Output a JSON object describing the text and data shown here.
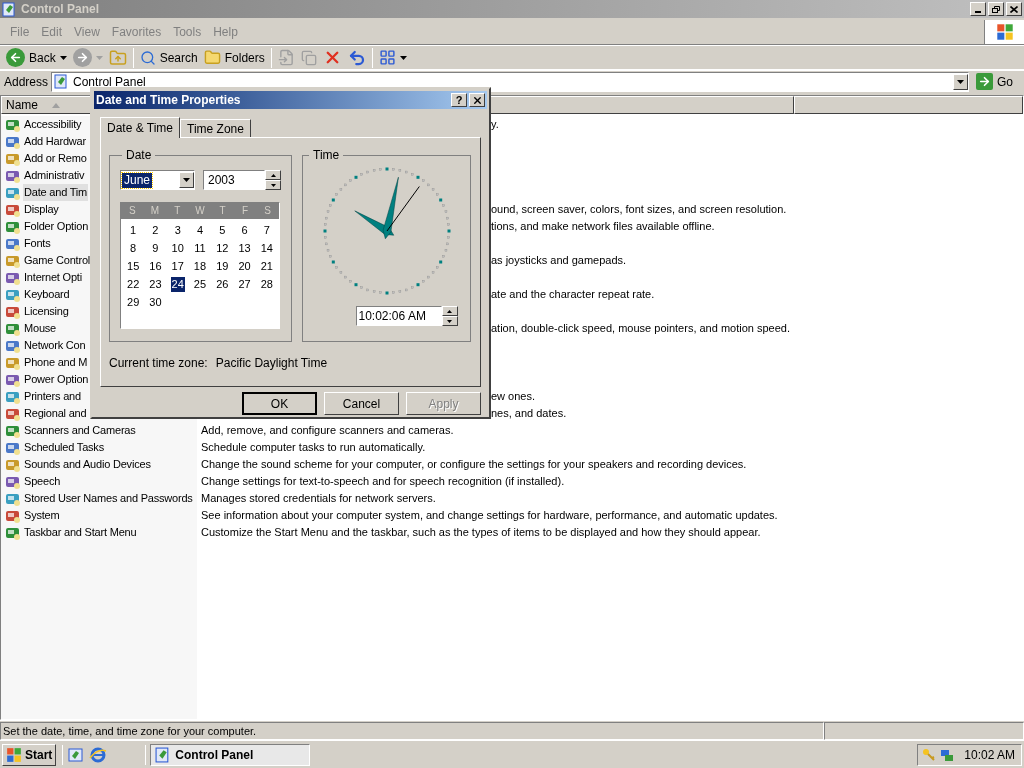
{
  "window": {
    "title": "Control Panel"
  },
  "menu": [
    "File",
    "Edit",
    "View",
    "Favorites",
    "Tools",
    "Help"
  ],
  "toolbar": [
    {
      "kind": "back",
      "label": "Back",
      "disabled": false
    },
    {
      "kind": "forward",
      "disabled": true
    },
    {
      "kind": "up",
      "disabled": false
    },
    {
      "kind": "search",
      "label": "Search",
      "disabled": false
    },
    {
      "kind": "folders",
      "label": "Folders",
      "disabled": false
    },
    {
      "kind": "move",
      "disabled": true
    },
    {
      "kind": "copy",
      "disabled": true
    },
    {
      "kind": "delete",
      "disabled": false
    },
    {
      "kind": "undo",
      "disabled": false
    },
    {
      "kind": "views",
      "disabled": false
    }
  ],
  "address": {
    "label": "Address",
    "value": "Control Panel",
    "go": "Go"
  },
  "list": {
    "columns": [
      "Name"
    ],
    "rows": [
      {
        "name": "Accessibility",
        "description": "y.",
        "kind": "covered",
        "selected": false
      },
      {
        "name": "Add Hardwar",
        "selected": false
      },
      {
        "name": "Add or Remo",
        "selected": false
      },
      {
        "name": "Administrativ",
        "selected": false
      },
      {
        "name": "Date and Tim",
        "selected": true
      },
      {
        "name": "Display",
        "description": "ound, screen saver, colors, font sizes, and screen resolution.",
        "kind": "covered",
        "selected": false
      },
      {
        "name": "Folder Option",
        "description": "tions, and make network files available offline.",
        "kind": "covered",
        "selected": false
      },
      {
        "name": "Fonts",
        "selected": false
      },
      {
        "name": "Game Control",
        "description": "as joysticks and gamepads.",
        "kind": "covered",
        "selected": false
      },
      {
        "name": "Internet Opti",
        "selected": false
      },
      {
        "name": "Keyboard",
        "description": "ate and the character repeat rate.",
        "kind": "covered",
        "selected": false
      },
      {
        "name": "Licensing",
        "selected": false
      },
      {
        "name": "Mouse",
        "description": "ation, double-click speed, mouse pointers, and motion speed.",
        "kind": "covered",
        "selected": false
      },
      {
        "name": "Network Con",
        "selected": false
      },
      {
        "name": "Phone and M",
        "selected": false
      },
      {
        "name": "Power Option",
        "selected": false
      },
      {
        "name": "Printers and",
        "description": "ew ones.",
        "kind": "covered",
        "selected": false
      },
      {
        "name": "Regional and",
        "description": "nes, and dates.",
        "kind": "covered",
        "selected": false
      },
      {
        "name": "Scanners and Cameras",
        "description": "Add, remove, and configure scanners and cameras.",
        "kind": "full",
        "selected": false
      },
      {
        "name": "Scheduled Tasks",
        "description": "Schedule computer tasks to run automatically.",
        "kind": "full",
        "selected": false
      },
      {
        "name": "Sounds and Audio Devices",
        "description": "Change the sound scheme for your computer, or configure the settings for your speakers and recording devices.",
        "kind": "full",
        "selected": false
      },
      {
        "name": "Speech",
        "description": "Change settings for text-to-speech and for speech recognition (if installed).",
        "kind": "full",
        "selected": false
      },
      {
        "name": "Stored User Names and Passwords",
        "description": "Manages stored credentials for network servers.",
        "kind": "full",
        "selected": false
      },
      {
        "name": "System",
        "description": "See information about your computer system, and change settings for hardware, performance, and automatic updates.",
        "kind": "full",
        "selected": false
      },
      {
        "name": "Taskbar and Start Menu",
        "description": "Customize the Start Menu and the taskbar, such as the types of items to be displayed and how they should appear.",
        "kind": "full",
        "selected": false
      }
    ]
  },
  "status_bar": "Set the date, time, and time zone for your computer.",
  "taskbar": {
    "start": "Start",
    "tasks": [
      {
        "label": "Control Panel",
        "selected": true
      }
    ],
    "clock": "10:02 AM"
  },
  "dialog": {
    "title": "Date and Time Properties",
    "help": "?",
    "tabs": [
      {
        "label": "Date & Time",
        "selected": true
      },
      {
        "label": "Time Zone",
        "selected": false
      }
    ],
    "date_group": "Date",
    "month": "June",
    "year": "2003",
    "weekdays": [
      "S",
      "M",
      "T",
      "W",
      "T",
      "F",
      "S"
    ],
    "days": [
      {
        "label": "1",
        "selected": false
      },
      {
        "label": "2",
        "selected": false
      },
      {
        "label": "3",
        "selected": false
      },
      {
        "label": "4",
        "selected": false
      },
      {
        "label": "5",
        "selected": false
      },
      {
        "label": "6",
        "selected": false
      },
      {
        "label": "7",
        "selected": false
      },
      {
        "label": "8",
        "selected": false
      },
      {
        "label": "9",
        "selected": false
      },
      {
        "label": "10",
        "selected": false
      },
      {
        "label": "11",
        "selected": false
      },
      {
        "label": "12",
        "selected": false
      },
      {
        "label": "13",
        "selected": false
      },
      {
        "label": "14",
        "selected": false
      },
      {
        "label": "15",
        "selected": false
      },
      {
        "label": "16",
        "selected": false
      },
      {
        "label": "17",
        "selected": false
      },
      {
        "label": "18",
        "selected": false
      },
      {
        "label": "19",
        "selected": false
      },
      {
        "label": "20",
        "selected": false
      },
      {
        "label": "21",
        "selected": false
      },
      {
        "label": "22",
        "selected": false
      },
      {
        "label": "23",
        "selected": false
      },
      {
        "label": "24",
        "selected": true
      },
      {
        "label": "25",
        "selected": false
      },
      {
        "label": "26",
        "selected": false
      },
      {
        "label": "27",
        "selected": false
      },
      {
        "label": "28",
        "selected": false
      },
      {
        "label": "29",
        "selected": false
      },
      {
        "label": "30",
        "selected": false
      }
    ],
    "time_group": "Time",
    "time": "10:02:06 AM",
    "timezone_label": "Current time zone:",
    "timezone": "Pacific Daylight Time",
    "buttons": [
      {
        "label": "OK",
        "kind": "default",
        "disabled": false
      },
      {
        "label": "Cancel",
        "kind": "normal",
        "disabled": false
      },
      {
        "label": "Apply",
        "kind": "normal",
        "disabled": true
      }
    ]
  }
}
